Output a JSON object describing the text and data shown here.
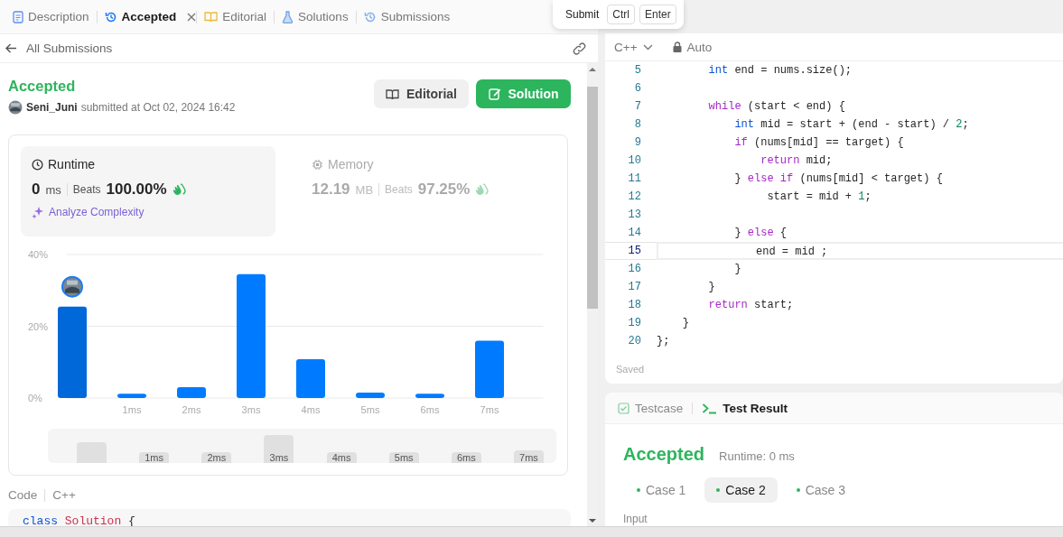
{
  "tabs": [
    {
      "label": "Description",
      "kind": "doc",
      "selected": false,
      "closable": false
    },
    {
      "label": "Accepted",
      "kind": "history",
      "selected": true,
      "closable": true
    },
    {
      "label": "Editorial",
      "kind": "book",
      "selected": false,
      "closable": false
    },
    {
      "label": "Solutions",
      "kind": "flask",
      "selected": false,
      "closable": false
    },
    {
      "label": "Submissions",
      "kind": "history",
      "selected": false,
      "closable": false
    }
  ],
  "tooltip": {
    "label": "Submit",
    "keys": [
      "Ctrl",
      "Enter"
    ]
  },
  "back_link": "All Submissions",
  "submission": {
    "status": "Accepted",
    "user": "Seni_Juni",
    "submitted": "submitted at Oct 02, 2024 16:42",
    "buttons": [
      {
        "label": "Editorial",
        "kind": "secondary"
      },
      {
        "label": "Solution",
        "kind": "primary"
      }
    ]
  },
  "stats": [
    {
      "title": "Runtime",
      "kind": "clock",
      "selected": true,
      "value": "0",
      "unit": "ms",
      "beats_label": "Beats",
      "beats": "100.00%",
      "action": "Analyze Complexity"
    },
    {
      "title": "Memory",
      "kind": "chip",
      "selected": false,
      "value": "12.19",
      "unit": "MB",
      "beats_label": "Beats",
      "beats": "97.25%"
    }
  ],
  "runtime_chart": {
    "chart_data": {
      "type": "bar",
      "x": [
        0,
        1,
        2,
        3,
        4,
        5,
        6,
        7
      ],
      "series": [
        {
          "color": "#007bff",
          "values": [
            25.5,
            1.2,
            3,
            34.5,
            10.8,
            1.5,
            1.2,
            16
          ]
        }
      ],
      "xlim": [
        -0.1,
        7.9
      ],
      "ylim": [
        0,
        40
      ],
      "yticks": [
        {
          "value": 0,
          "label": "0%"
        },
        {
          "value": 20,
          "label": "20%"
        },
        {
          "value": 40,
          "label": "40%"
        }
      ],
      "xticks": [
        {
          "value": 1,
          "label": "1ms"
        },
        {
          "value": 2,
          "label": "2ms"
        },
        {
          "value": 3,
          "label": "3ms"
        },
        {
          "value": 4,
          "label": "4ms"
        },
        {
          "value": 5,
          "label": "5ms"
        },
        {
          "value": 6,
          "label": "6ms"
        },
        {
          "value": 7,
          "label": "7ms"
        }
      ]
    },
    "bars": [
      {
        "selected": true
      },
      {
        "selected": false
      },
      {
        "selected": false
      },
      {
        "selected": false
      },
      {
        "selected": false
      },
      {
        "selected": false
      },
      {
        "selected": false
      },
      {
        "selected": false
      }
    ],
    "overview_labels": [
      "1ms",
      "2ms",
      "3ms",
      "4ms",
      "5ms",
      "6ms",
      "7ms"
    ]
  },
  "code": {
    "label": "Code",
    "language": "C++",
    "tokens": [
      {
        "kind": "type",
        "text": "class"
      },
      {
        "kind": "class",
        "text": " Solution"
      },
      {
        "kind": "plain",
        "text": " {"
      }
    ]
  },
  "editor": {
    "language": "C++",
    "mode": "Auto",
    "status": "Saved",
    "lines": [
      {
        "number": "5",
        "current": false,
        "tokens": [
          {
            "kind": "type",
            "text": "        int"
          },
          {
            "kind": "plain",
            "text": " end = nums.size();"
          }
        ]
      },
      {
        "number": "6",
        "current": false
      },
      {
        "number": "7",
        "current": false,
        "tokens": [
          {
            "kind": "keyword",
            "text": "        while"
          },
          {
            "kind": "plain",
            "text": " (start < end) {"
          }
        ]
      },
      {
        "number": "8",
        "current": false,
        "tokens": [
          {
            "kind": "type",
            "text": "            int"
          },
          {
            "kind": "plain",
            "text": " mid = start + (end - start) / "
          },
          {
            "kind": "number",
            "text": "2"
          },
          {
            "kind": "plain",
            "text": ";"
          }
        ]
      },
      {
        "number": "9",
        "current": false,
        "tokens": [
          {
            "kind": "keyword",
            "text": "            if"
          },
          {
            "kind": "plain",
            "text": " (nums[mid] == target) {"
          }
        ]
      },
      {
        "number": "10",
        "current": false,
        "tokens": [
          {
            "kind": "keyword",
            "text": "                return"
          },
          {
            "kind": "plain",
            "text": " mid;"
          }
        ]
      },
      {
        "number": "11",
        "current": false,
        "tokens": [
          {
            "kind": "plain",
            "text": "            } "
          },
          {
            "kind": "keyword",
            "text": "else if"
          },
          {
            "kind": "plain",
            "text": " (nums[mid] < target) {"
          }
        ]
      },
      {
        "number": "12",
        "current": false,
        "tokens": [
          {
            "kind": "plain",
            "text": "                 start = mid + "
          },
          {
            "kind": "number",
            "text": "1"
          },
          {
            "kind": "plain",
            "text": ";"
          }
        ]
      },
      {
        "number": "13",
        "current": false
      },
      {
        "number": "14",
        "current": false,
        "tokens": [
          {
            "kind": "plain",
            "text": "            } "
          },
          {
            "kind": "keyword",
            "text": "else"
          },
          {
            "kind": "plain",
            "text": " {"
          }
        ]
      },
      {
        "number": "15",
        "current": true,
        "tokens": [
          {
            "kind": "plain",
            "text": "               end = mid ;"
          }
        ]
      },
      {
        "number": "16",
        "current": false,
        "tokens": [
          {
            "kind": "plain",
            "text": "            }"
          }
        ]
      },
      {
        "number": "17",
        "current": false,
        "tokens": [
          {
            "kind": "plain",
            "text": "        }"
          }
        ]
      },
      {
        "number": "18",
        "current": false,
        "tokens": [
          {
            "kind": "keyword",
            "text": "        return"
          },
          {
            "kind": "plain",
            "text": " start;"
          }
        ]
      },
      {
        "number": "19",
        "current": false,
        "tokens": [
          {
            "kind": "plain",
            "text": "    }"
          }
        ]
      },
      {
        "number": "20",
        "current": false,
        "tokens": [
          {
            "kind": "plain",
            "text": "};"
          }
        ]
      }
    ]
  },
  "results": {
    "tabs": [
      {
        "label": "Testcase",
        "kind": "check",
        "selected": false
      },
      {
        "label": "Test Result",
        "kind": "terminal",
        "selected": true
      }
    ],
    "status": "Accepted",
    "runtime": "Runtime: 0 ms",
    "cases": [
      {
        "label": "Case 1",
        "selected": false
      },
      {
        "label": "Case 2",
        "selected": true
      },
      {
        "label": "Case 3",
        "selected": false
      }
    ],
    "section": "Input"
  }
}
